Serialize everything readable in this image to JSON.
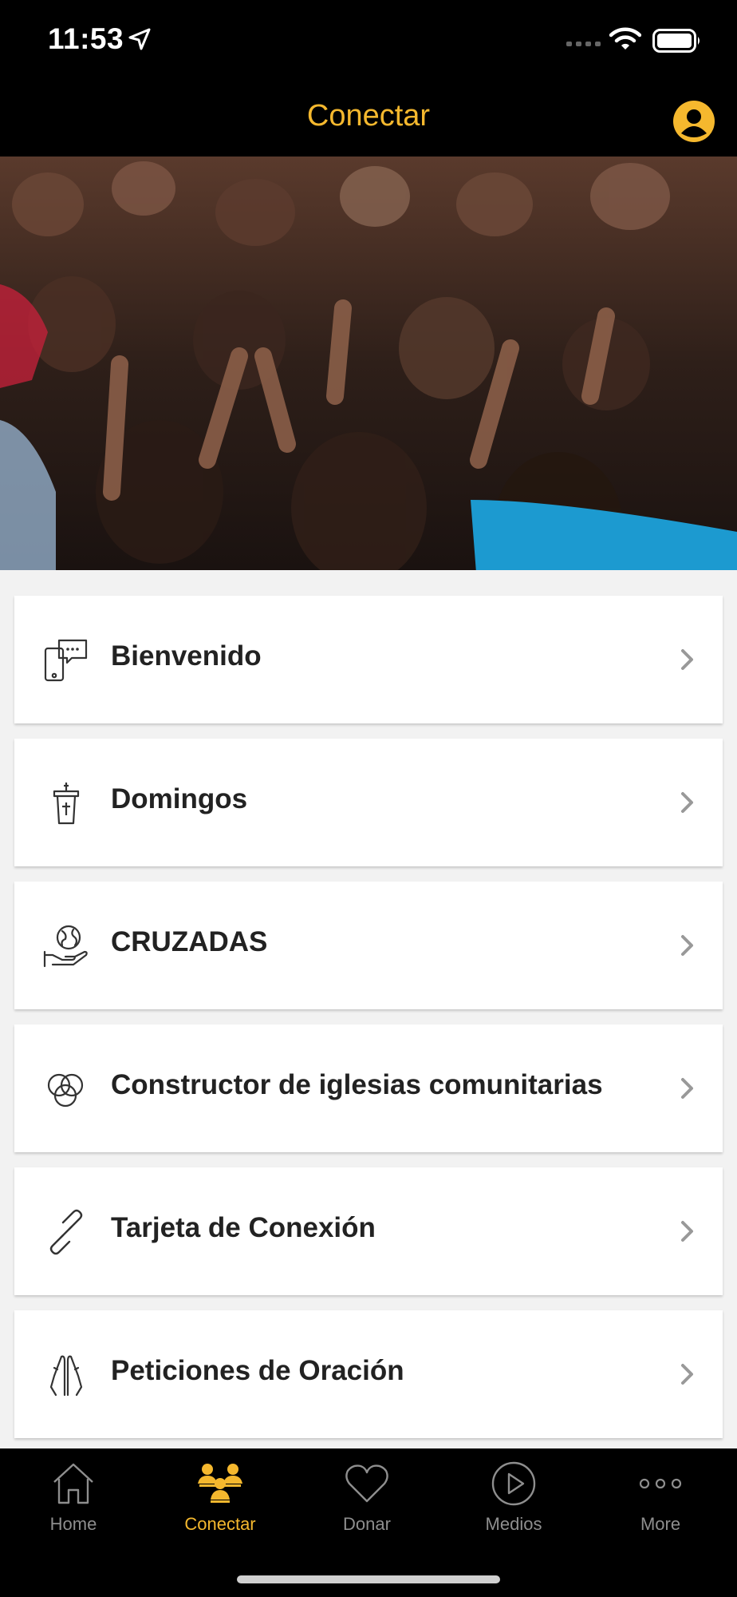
{
  "status_bar": {
    "time": "11:53"
  },
  "header": {
    "title": "Conectar"
  },
  "menu": {
    "items": [
      {
        "label": "Bienvenido",
        "icon": "phone-chat-icon"
      },
      {
        "label": "Domingos",
        "icon": "pulpit-icon"
      },
      {
        "label": "CRUZADAS",
        "icon": "globe-hand-icon"
      },
      {
        "label": "Constructor de iglesias comunitarias",
        "icon": "circles-icon"
      },
      {
        "label": "Tarjeta de Conexión",
        "icon": "link-icon"
      },
      {
        "label": "Peticiones de Oración",
        "icon": "praying-hands-icon"
      }
    ]
  },
  "tab_bar": {
    "tabs": [
      {
        "label": "Home",
        "icon": "home-icon",
        "active": false
      },
      {
        "label": "Conectar",
        "icon": "people-icon",
        "active": true
      },
      {
        "label": "Donar",
        "icon": "heart-icon",
        "active": false
      },
      {
        "label": "Medios",
        "icon": "play-icon",
        "active": false
      },
      {
        "label": "More",
        "icon": "more-icon",
        "active": false
      }
    ]
  },
  "colors": {
    "accent": "#f5b82e",
    "bar_background": "#000000",
    "page_background": "#f2f2f2",
    "inactive_tab": "#8e8e8e"
  }
}
